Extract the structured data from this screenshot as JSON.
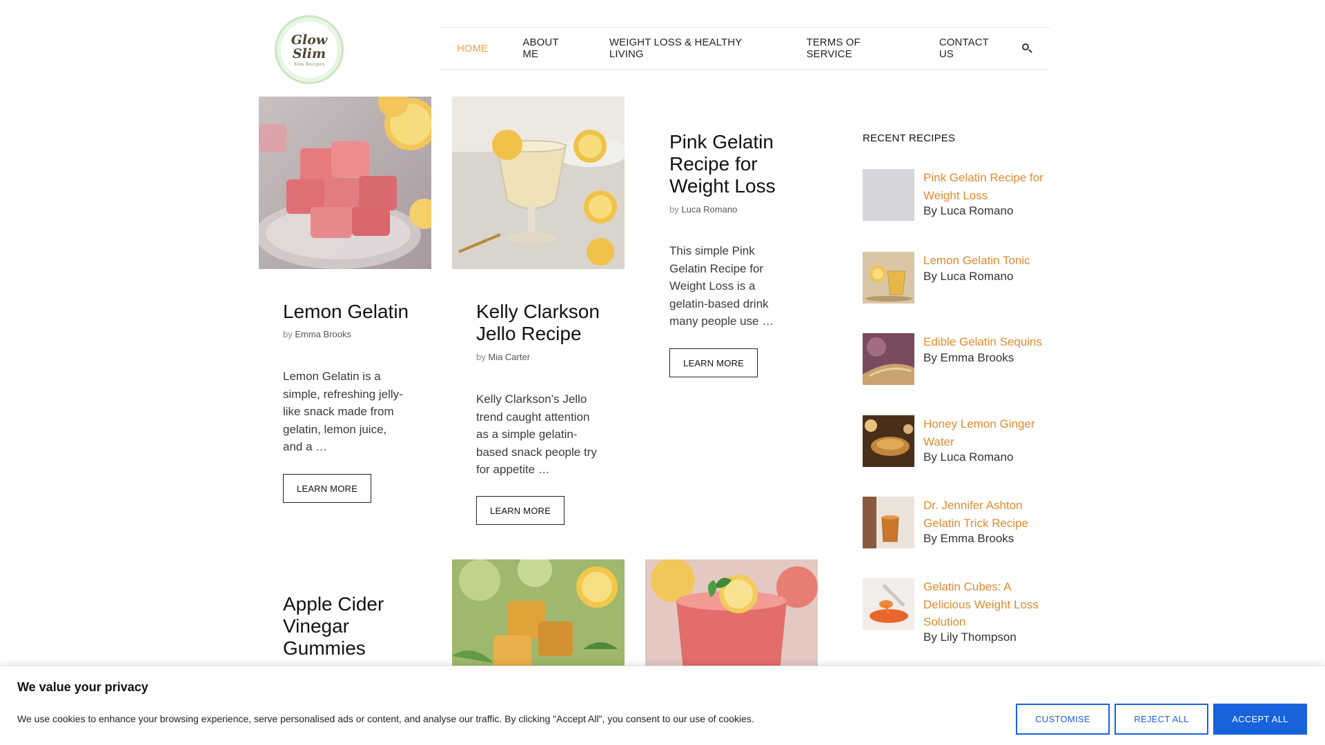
{
  "logo": {
    "line1": "Glow",
    "line2": "Slim",
    "line3": "Slim Recipes"
  },
  "nav": {
    "items": [
      {
        "label": "HOME",
        "active": true
      },
      {
        "label": "ABOUT ME",
        "active": false
      },
      {
        "label": "WEIGHT LOSS & HEALTHY LIVING",
        "active": false
      },
      {
        "label": "TERMS OF SERVICE",
        "active": false
      },
      {
        "label": "CONTACT US",
        "active": false
      }
    ],
    "search_icon": "search-icon",
    "active_color": "#e8a54b"
  },
  "posts": [
    {
      "title": "Lemon Gelatin",
      "by": "by",
      "author": "Emma Brooks",
      "excerpt": "Lemon Gelatin is a simple, refreshing jelly-like snack made from gelatin, lemon juice, and a …",
      "button": "LEARN MORE"
    },
    {
      "title": "Kelly Clarkson Jello Recipe",
      "by": "by",
      "author": "Mia Carter",
      "excerpt": "Kelly Clarkson’s Jello trend caught attention as a simple gelatin-based snack people try for appetite …",
      "button": "LEARN MORE"
    },
    {
      "title": "Pink Gelatin Recipe for Weight Loss",
      "by": "by",
      "author": "Luca Romano",
      "excerpt": "This simple Pink Gelatin Recipe for Weight Loss is a gelatin-based drink many people use …",
      "button": "LEARN MORE"
    },
    {
      "title": "Apple Cider Vinegar Gummies"
    }
  ],
  "sidebar": {
    "title": "RECENT RECIPES",
    "items": [
      {
        "title": "Pink Gelatin Recipe for Weight Loss",
        "by": "By Luca Romano"
      },
      {
        "title": "Lemon Gelatin Tonic",
        "by": "By Luca Romano"
      },
      {
        "title": "Edible Gelatin Sequins",
        "by": "By Emma Brooks"
      },
      {
        "title": "Honey Lemon Ginger Water",
        "by": "By Luca Romano"
      },
      {
        "title": "Dr. Jennifer Ashton Gelatin Trick Recipe",
        "by": "By Emma Brooks"
      },
      {
        "title": "Gelatin Cubes: A Delicious Weight Loss Solution",
        "by": "By Lily Thompson"
      }
    ]
  },
  "cookie": {
    "title": "We value your privacy",
    "text": "We use cookies to enhance your browsing experience, serve personalised ads or content, and analyse our traffic. By clicking \"Accept All\", you consent to our use of cookies.",
    "customise": "CUSTOMISE",
    "reject": "REJECT ALL",
    "accept": "ACCEPT ALL",
    "accent_color": "#1863dc"
  }
}
